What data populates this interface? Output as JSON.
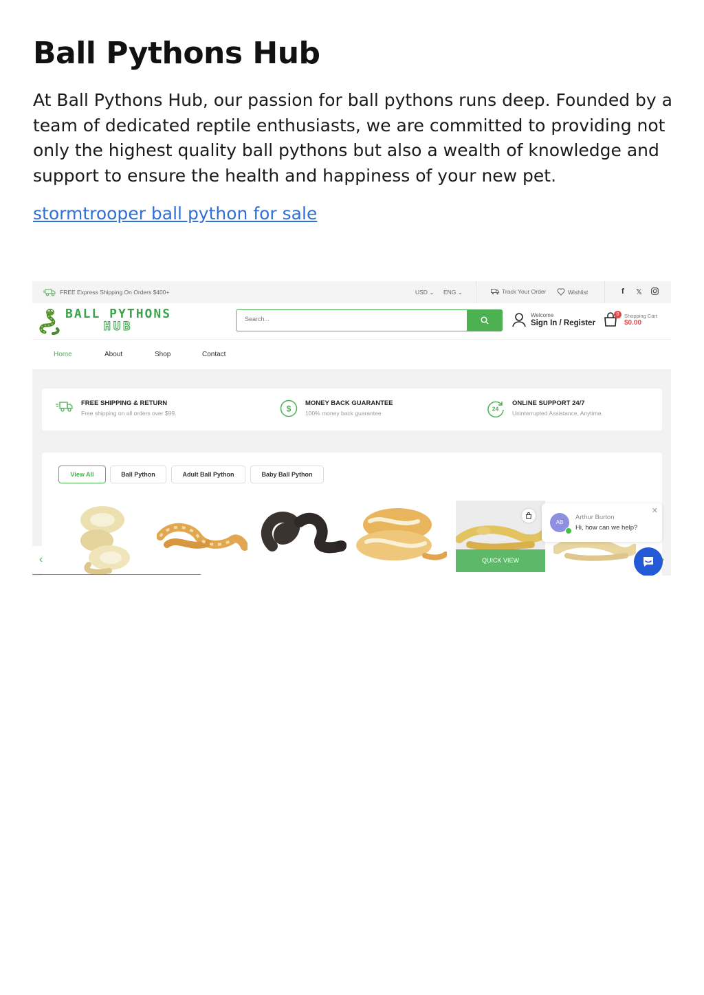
{
  "doc": {
    "title": "Ball Pythons Hub",
    "intro": "At Ball Pythons Hub, our passion for ball pythons runs deep. Founded by a team of dedicated reptile enthusiasts, we are committed to providing not only the highest quality ball pythons but also a wealth of knowledge and support to ensure the health and happiness of your new pet.",
    "link_text": "stormtrooper ball python for sale"
  },
  "site": {
    "topbar": {
      "shipping": "FREE Express Shipping On Orders $400+",
      "currency": "USD",
      "language": "ENG",
      "track": "Track Your Order",
      "wishlist": "Wishlist",
      "social_icons": [
        "facebook-icon",
        "x-icon",
        "instagram-icon"
      ]
    },
    "logo": {
      "line1": "BALL PYTHONS",
      "line2": "HUB"
    },
    "search": {
      "placeholder": "Search..."
    },
    "account": {
      "welcome": "Welcome",
      "sign_in": "Sign In / Register"
    },
    "cart": {
      "count": "0",
      "label": "Shopping Cart",
      "amount": "$0.00"
    },
    "nav": [
      "Home",
      "About",
      "Shop",
      "Contact"
    ],
    "features": [
      {
        "title": "FREE SHIPPING & RETURN",
        "subtitle": "Free shipping on all orders over $99.",
        "icon": "truck-icon"
      },
      {
        "title": "MONEY BACK GUARANTEE",
        "subtitle": "100% money back guarantee",
        "icon": "dollar-icon"
      },
      {
        "title": "ONLINE SUPPORT 24/7",
        "subtitle": "Uninterrupted Assistance, Anytime.",
        "icon": "support-24-icon"
      }
    ],
    "tabs": [
      "View All",
      "Ball Python",
      "Adult Ball Python",
      "Baby Ball Python"
    ],
    "quick_view": "QUICK VIEW",
    "chat": {
      "initials": "AB",
      "name": "Arthur Burton",
      "message": "Hi, how can we help?"
    },
    "colors": {
      "accent": "#4caf50",
      "badge": "#e24a4a",
      "link": "#2f6fd6",
      "chat_button": "#2358d6"
    }
  }
}
